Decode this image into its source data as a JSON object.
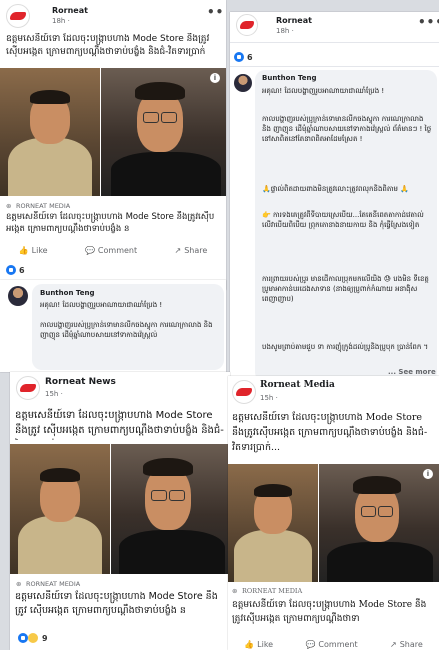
{
  "page_name": "Rorneat",
  "time_18h": "18h ·",
  "post_text_short": "ឧត្តមសេនីយ៍ទោ ដែលចុះបង្ក្រាបហាង Mode Store នឹងត្រូវស៊ើបអង្កេត ក្រោមពាក្យបណ្ដឹងថាទាប់បង្ខំង និងជំ-វិតទារប្រាក់",
  "link_source": "RORNEAT MEDIA",
  "link_title": "ឧត្តមសេនីយ៍ទោ ដែលចុះបង្ក្រាបហាង Mode Store នឹងត្រូវស៊ើបអង្កេត ក្រោមពាក្យបណ្ដឹងថាទាប់បង្ខំង ន",
  "like_label": "Like",
  "comment_label": "Comment",
  "share_label": "Share",
  "reaction_count_6": "6",
  "commenter": "Bunthon Teng",
  "comment_p1": "អគុណ! ដែលបង្ហាញរូបអាណាយាជាឈាំប្រែង !",
  "comment_p2": "កាលបង្ហាញរបស់ប្រូក្រាន់ទោមានលីកចងស្ទុកា ការណេក្រាលាង និង ញាញុន ដើមុំឆ្នាំណាបសាយនៅទាកាងវ៉េស្រ្តល់",
  "comment_p2_full": "កាលបង្ហាញរបស់ប្រូក្រាន់ទោមានលីកចងស្ទុកា ការណេក្រាលាង និង ញាញុន ដើមុំឆ្នាំណាបសាយនៅទាកាងវ៉េស្រ្តល់ ព័ត៌មានៗ ! ថ្ងៃនៅសាពិតនៅតែនាពពិតអាដែមស្រែត !",
  "comment_p3": "🙏ផ្ទាល់ពិតដាយពាងមិនត្រូវលោះត្រូវពលុកនិងពិតាម 🙏",
  "comment_p4": "👉 ការទងគេត្រូវពីទីបាយស្រេបើយ...តែតេនីពេតតាកាដ់វេតាល់ លើវាបើយពិបើយ ព្រុកតោនាងនាយកាយ និង កុំធ្វើស្រែងទៀត",
  "comment_p5": "ការព្រាយរបស់ប្រូរ មានដេីកាលប្រុកមកលើយិង 😓 បងមិន ទីខេត្តប្រូមាអាកាន់បរដេងសាទាន (នាងឲ្យប្រូពាក់កំណាយ អនាង៉ិសពេញាញាប)",
  "comment_p6": "បងសូមព្រាប់តាមជួប ទា ការញុំក្រូង់ដល់ប្រូនិងប្រូបុក ប្រាន់ពែក ។",
  "see_more": "... See more",
  "news_name": "Rorneat News",
  "time_15h": "15h ·",
  "post_text_news": "ឧត្តមសេនីយ៍ទោ ដែលចុះបង្ក្រាបហាង Mode Store នឹងត្រូវ ស៊ើបអង្កេត ក្រោមពាក្យបណ្ដឹងថាទាប់បង្ខំង និងជំ-វិតទារប្រាក់",
  "link_title_news": "ឧត្តមសេនីយ៍ទោ ដែលចុះបង្ក្រាបហាង Mode Store នឹងត្រូវ ស៊ើបអង្កេត ក្រោមពាក្យបណ្ដឹងថាទាប់បង្ខំង ន",
  "reaction_count_9": "9",
  "media_name": "Rorneat Media",
  "post_text_media": "ឧត្តមសេនីយ៍ទោ ដែលចុះបង្ក្រាបហាង Mode Store នឹងត្រូវស៊ើបអង្កេត ក្រោមពាក្យបណ្ដឹងថាទាប់បង្ខំង និងជំ-វិតទារប្រាក់...",
  "link_title_media": "ឧត្តមសេនីយ៍ទោ ដែលចុះបង្ក្រាបហាង Mode Store នឹងត្រូវស៊ើបអង្កេត ក្រោមពាក្យបណ្ដឹងថាទា",
  "dots": "•••"
}
